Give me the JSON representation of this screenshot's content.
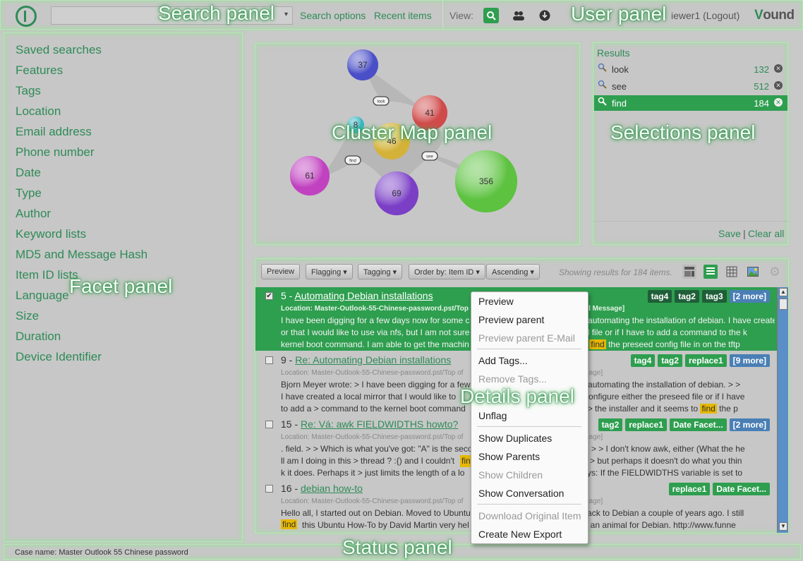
{
  "panel_labels": {
    "search": "Search panel",
    "user": "User panel",
    "facet": "Facet panel",
    "cluster": "Cluster Map panel",
    "selections": "Selections panel",
    "details": "Details panel",
    "status": "Status panel"
  },
  "topbar": {
    "search_options": "Search options",
    "recent_items": "Recent items",
    "view_label": "View:",
    "user": "iewer1",
    "logout": "(Logout)",
    "brand_v": "V",
    "brand_rest": "ound"
  },
  "facets": [
    "Saved searches",
    "Features",
    "Tags",
    "Location",
    "Email address",
    "Phone number",
    "Date",
    "Type",
    "Author",
    "Keyword lists",
    "MD5 and Message Hash",
    "Item ID lists",
    "Language",
    "Size",
    "Duration",
    "Device Identifier"
  ],
  "cluster_map": {
    "nodes": [
      {
        "label": "37",
        "color": "#4a4fc7"
      },
      {
        "label": "41",
        "color": "#d04a4a"
      },
      {
        "label": "8",
        "color": "#3ab5c2"
      },
      {
        "label": "46",
        "color": "#d4b23a"
      },
      {
        "label": "61",
        "color": "#c142c0"
      },
      {
        "label": "69",
        "color": "#7b3fc6"
      },
      {
        "label": "356",
        "color": "#5cc23f"
      }
    ],
    "terms": [
      "look",
      "find",
      "see"
    ]
  },
  "selections": {
    "title": "Results",
    "rows": [
      {
        "term": "look",
        "count": "132"
      },
      {
        "term": "see",
        "count": "512"
      },
      {
        "term": "find",
        "count": "184"
      }
    ],
    "save": "Save",
    "sep": "|",
    "clear": "Clear all"
  },
  "toolbar": {
    "preview": "Preview",
    "flagging": "Flagging",
    "tagging": "Tagging",
    "order": "Order by: Item ID",
    "ascending": "Ascending",
    "showing": "Showing results for 184 items."
  },
  "results": [
    {
      "num": "5 - ",
      "title": "Automating Debian installations",
      "loc_left": "Location: Master-Outlook-55-Chinese-password.pst/Top",
      "loc_right": "n [Email Message]",
      "lines_left": [
        "I have been digging for a few days now for some c",
        "or that I would like to use via nfs, but I am not sure",
        "kernel boot command. I am able to get the machin"
      ],
      "lines_right": [
        "n on > automating the installation of debian. I have created a local mirr",
        "peseed file or if I have to add a command to the k",
        "ems to"
      ],
      "hl_after": "the preseed config file in on the tftp",
      "hl": "find",
      "tags": [
        "tag4",
        "tag2",
        "tag3"
      ],
      "more": "[2 more]"
    },
    {
      "num": "9 - ",
      "title": "Re: Automating Debian installations",
      "loc_left": "Location: Master-Outlook-55-Chinese-password.pst/Top of",
      "loc_right": "ail Message]",
      "lines_left": [
        "Bjorn Meyer wrote: > I have been digging for a few",
        "I have created a local mirror that I would like to",
        "to add a > command to the kernel boot command"
      ],
      "lines_right": [
        "n on > automating the installation of debian. > >",
        "ow to configure either the preseed file or if I have",
        "o boot > the installer and it seems to"
      ],
      "hl_after": "the p",
      "hl": "find",
      "tags": [
        "tag4",
        "tag2",
        "replace1"
      ],
      "more": "[9 more]"
    },
    {
      "num": "15 - ",
      "title": "Re: Vá: awk FIELDWIDTHS howto?",
      "loc_left": "Location: Master-Outlook-55-Chinese-password.pst/Top of",
      "loc_right": "ail Message]",
      "lines_left": [
        ". field. > > Which is what you've got: \"A\" is the seco",
        "ll am I doing in this > thread ? :{) and I couldn't",
        "k it does. Perhaps it > just limits the length of a lo"
      ],
      "lines_right": [
        "\" 4 32 \" > > I don't know awk, either (What the he",
        "npage, > but perhaps it doesn't do what you thin",
        "age says: If the FIELDWIDTHS variable is set to"
      ],
      "hl_mid": "find",
      "tags": [
        "tag2",
        "replace1",
        "Date Facet..."
      ],
      "more": "[2 more]"
    },
    {
      "num": "16 - ",
      "title": "debian how-to",
      "loc_left": "Location: Master-Outlook-55-Chinese-password.pst/Top of",
      "loc_right": "ail Message]",
      "lines_left": [
        "Hello all, I started out on Debian. Moved to Ubuntu",
        "this Ubuntu How-To by David Martin very hel"
      ],
      "lines_right": [
        "oved back to Debian a couple of years ago. I still",
        "is such an animal for Debian. http://www.funne"
      ],
      "hl": "find",
      "tags": [
        "replace1",
        "Date Facet..."
      ]
    }
  ],
  "context_menu": {
    "preview": "Preview",
    "preview_parent": "Preview parent",
    "preview_parent_email": "Preview parent E-Mail",
    "add_tags": "Add Tags...",
    "remove_tags": "Remove Tags...",
    "unflag": "Unflag",
    "show_duplicates": "Show Duplicates",
    "show_parents": "Show Parents",
    "show_children": "Show Children",
    "show_conversation": "Show Conversation",
    "download_original": "Download Original Item",
    "create_export": "Create New Export"
  },
  "status": {
    "case_name": "Case name: Master Outlook 55 Chinese password"
  }
}
